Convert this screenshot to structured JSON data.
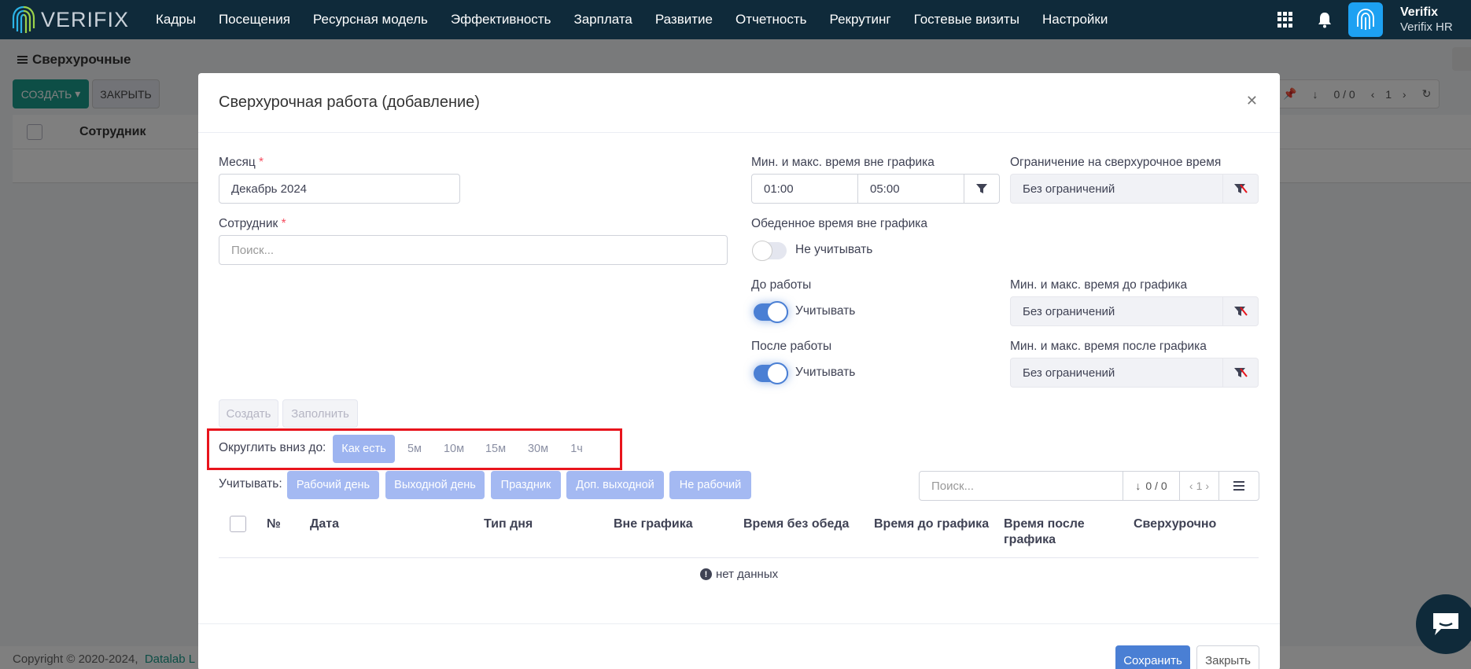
{
  "app": {
    "logo_text": "VERIFIX",
    "user_name": "Verifix",
    "user_sub": "Verifix HR"
  },
  "nav": [
    "Кадры",
    "Посещения",
    "Ресурсная модель",
    "Эффективность",
    "Зарплата",
    "Развитие",
    "Отчетность",
    "Рекрутинг",
    "Гостевые визиты",
    "Настройки"
  ],
  "bg": {
    "page_title": "Сверхурочные",
    "create": "СОЗДАТЬ",
    "close": "ЗАКРЫТЬ",
    "col_employee": "Сотрудник",
    "counter": "0 / 0",
    "page": "1",
    "footer_prefix": "Copyright © 2020-2024,",
    "footer_link": "Datalab L"
  },
  "modal": {
    "title": "Сверхурочная работа (добавление)",
    "month_label": "Месяц",
    "month_value": "Декабрь 2024",
    "employee_label": "Сотрудник",
    "employee_placeholder": "Поиск...",
    "minmax_label": "Мин. и макс. время вне графика",
    "min_value": "01:00",
    "max_value": "05:00",
    "limit_label": "Ограничение на сверхурочное время",
    "limit_value": "Без ограничений",
    "lunch_label": "Обеденное время вне графика",
    "lunch_toggle": "Не учитывать",
    "before_label": "До работы",
    "before_toggle": "Учитывать",
    "before_minmax_label": "Мин. и макс. время до графика",
    "before_minmax_value": "Без ограничений",
    "after_label": "После работы",
    "after_toggle": "Учитывать",
    "after_minmax_label": "Мин. и макс. время после графика",
    "after_minmax_value": "Без ограничений",
    "btn_create": "Создать",
    "btn_fill": "Заполнить",
    "round_label": "Округлить вниз до:",
    "round_options": [
      "Как есть",
      "5м",
      "10м",
      "15м",
      "30м",
      "1ч"
    ],
    "count_label": "Учитывать:",
    "count_options": [
      "Рабочий день",
      "Выходной день",
      "Праздник",
      "Доп. выходной",
      "Не рабочий"
    ],
    "table_search_placeholder": "Поиск...",
    "table_counter": "0 / 0",
    "table_page": "1",
    "columns": [
      "№",
      "Дата",
      "Тип дня",
      "Вне графика",
      "Время без обеда",
      "Время до графика",
      "Время после графика",
      "Сверхурочно"
    ],
    "no_data": "нет данных",
    "save": "Сохранить",
    "close": "Закрыть"
  },
  "colors": {
    "navbar": "#0f2a3a",
    "accent": "#4a7fd4",
    "create_btn": "#1a9c8c",
    "highlight": "#e8141c"
  }
}
